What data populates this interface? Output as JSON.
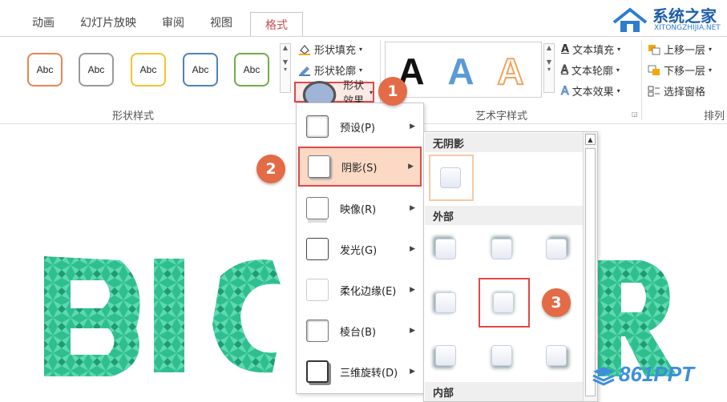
{
  "tabs": [
    "动画",
    "幻灯片放映",
    "审阅",
    "视图",
    "格式"
  ],
  "active_tab_index": 4,
  "shape_styles": {
    "label": "形状样式",
    "presets": [
      {
        "text": "Abc",
        "border": "#e8854f"
      },
      {
        "text": "Abc",
        "border": "#9a9a9a"
      },
      {
        "text": "Abc",
        "border": "#f2c232"
      },
      {
        "text": "Abc",
        "border": "#4f81bd"
      },
      {
        "text": "Abc",
        "border": "#70ad47"
      }
    ],
    "commands": [
      "形状填充",
      "形状轮廓",
      "形状效果"
    ]
  },
  "wordart": {
    "label": "艺术字样式",
    "letters": [
      {
        "text": "A",
        "color": "#111111"
      },
      {
        "text": "A",
        "color": "#5b9bd5"
      },
      {
        "text": "A",
        "color": "#f2a45c"
      }
    ],
    "commands": [
      "文本填充",
      "文本轮廓",
      "文本效果"
    ]
  },
  "arrange": {
    "label": "排列",
    "commands": [
      "上移一层",
      "下移一层",
      "选择窗格"
    ]
  },
  "effects_menu": [
    {
      "label": "预设(P)"
    },
    {
      "label": "阴影(S)"
    },
    {
      "label": "映像(R)"
    },
    {
      "label": "发光(G)"
    },
    {
      "label": "柔化边缘(E)"
    },
    {
      "label": "棱台(B)"
    },
    {
      "label": "三维旋转(D)"
    }
  ],
  "shadow_submenu": {
    "sections": [
      "无阴影",
      "外部",
      "内部"
    ]
  },
  "callouts": [
    "1",
    "2",
    "3"
  ],
  "watermark_top": {
    "title": "系统之家",
    "url": "XITONGZHIJIA.NET"
  },
  "watermark_bottom": "861PPT",
  "canvas_text": "BIG R",
  "colors": {
    "accent": "#c0504d",
    "highlight": "#e04848",
    "callout": "#e36b46",
    "shard": "#2fbf8f"
  }
}
